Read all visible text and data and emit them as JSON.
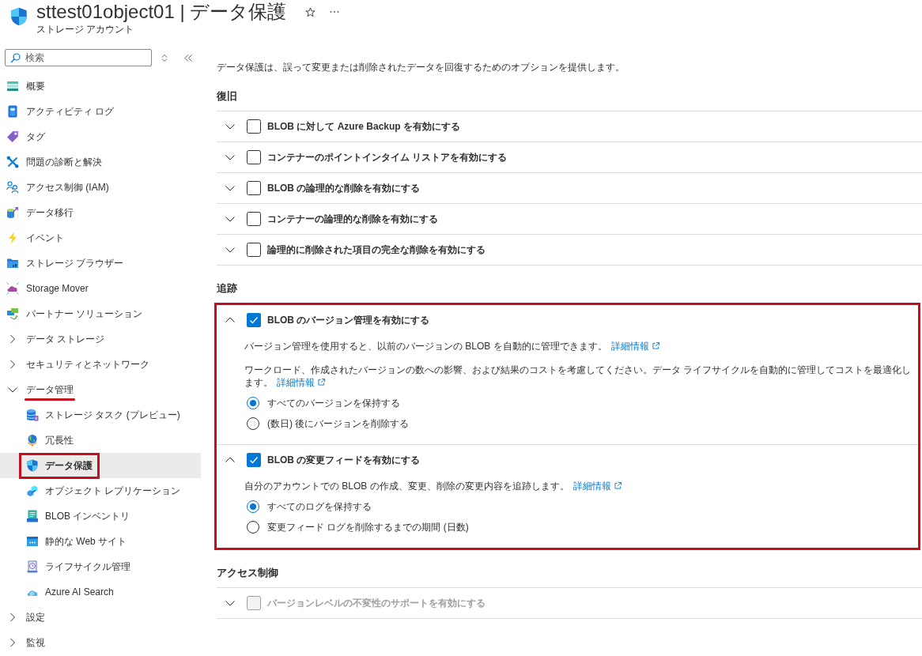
{
  "header": {
    "title": "sttest01object01 | データ保護",
    "subtitle": "ストレージ アカウント"
  },
  "sidebar": {
    "search": {
      "placeholder": "検索"
    },
    "items": [
      {
        "label": "概要",
        "kind": "link",
        "selected": false,
        "highlighted": false,
        "underlined": false
      },
      {
        "label": "アクティビティ ログ",
        "kind": "link",
        "selected": false,
        "highlighted": false,
        "underlined": false
      },
      {
        "label": "タグ",
        "kind": "link",
        "selected": false,
        "highlighted": false,
        "underlined": false
      },
      {
        "label": "問題の診断と解決",
        "kind": "link",
        "selected": false,
        "highlighted": false,
        "underlined": false
      },
      {
        "label": "アクセス制御 (IAM)",
        "kind": "link",
        "selected": false,
        "highlighted": false,
        "underlined": false
      },
      {
        "label": "データ移行",
        "kind": "link",
        "selected": false,
        "highlighted": false,
        "underlined": false
      },
      {
        "label": "イベント",
        "kind": "link",
        "selected": false,
        "highlighted": false,
        "underlined": false
      },
      {
        "label": "ストレージ ブラウザー",
        "kind": "link",
        "selected": false,
        "highlighted": false,
        "underlined": false
      },
      {
        "label": "Storage Mover",
        "kind": "link",
        "selected": false,
        "highlighted": false,
        "underlined": false
      },
      {
        "label": "パートナー ソリューション",
        "kind": "link",
        "selected": false,
        "highlighted": false,
        "underlined": false
      },
      {
        "label": "データ ストレージ",
        "kind": "group",
        "expanded": false,
        "selected": false,
        "highlighted": false,
        "underlined": false
      },
      {
        "label": "セキュリティとネットワーク",
        "kind": "group",
        "expanded": false,
        "selected": false,
        "highlighted": false,
        "underlined": false
      },
      {
        "label": "データ管理",
        "kind": "group",
        "expanded": true,
        "selected": false,
        "highlighted": false,
        "underlined": true,
        "children": [
          {
            "label": "ストレージ タスク (プレビュー)",
            "kind": "link",
            "selected": false,
            "highlighted": false,
            "underlined": false
          },
          {
            "label": "冗長性",
            "kind": "link",
            "selected": false,
            "highlighted": false,
            "underlined": false
          },
          {
            "label": "データ保護",
            "kind": "link",
            "selected": true,
            "highlighted": true,
            "underlined": false
          },
          {
            "label": "オブジェクト レプリケーション",
            "kind": "link",
            "selected": false,
            "highlighted": false,
            "underlined": false
          },
          {
            "label": "BLOB インベントリ",
            "kind": "link",
            "selected": false,
            "highlighted": false,
            "underlined": false
          },
          {
            "label": "静的な Web サイト",
            "kind": "link",
            "selected": false,
            "highlighted": false,
            "underlined": false
          },
          {
            "label": "ライフサイクル管理",
            "kind": "link",
            "selected": false,
            "highlighted": false,
            "underlined": false
          },
          {
            "label": "Azure AI Search",
            "kind": "link",
            "selected": false,
            "highlighted": false,
            "underlined": false
          }
        ]
      },
      {
        "label": "設定",
        "kind": "group",
        "expanded": false,
        "selected": false,
        "highlighted": false,
        "underlined": false
      },
      {
        "label": "監視",
        "kind": "group",
        "expanded": false,
        "selected": false,
        "highlighted": false,
        "underlined": false
      }
    ]
  },
  "main": {
    "description": "データ保護は、誤って変更または削除されたデータを回復するためのオプションを提供します。",
    "sections": [
      {
        "heading": "復旧",
        "highlighted": false,
        "items": [
          {
            "label": "BLOB に対して Azure Backup を有効にする",
            "checked": false,
            "expanded": false,
            "disabled": false
          },
          {
            "label": "コンテナーのポイントインタイム リストアを有効にする",
            "checked": false,
            "expanded": false,
            "disabled": false
          },
          {
            "label": "BLOB の論理的な削除を有効にする",
            "checked": false,
            "expanded": false,
            "disabled": false
          },
          {
            "label": "コンテナーの論理的な削除を有効にする",
            "checked": false,
            "expanded": false,
            "disabled": false
          },
          {
            "label": "論理的に削除された項目の完全な削除を有効にする",
            "checked": false,
            "expanded": false,
            "disabled": false
          }
        ]
      },
      {
        "heading": "追跡",
        "highlighted": true,
        "items": [
          {
            "label": "BLOB のバージョン管理を有効にする",
            "checked": true,
            "expanded": true,
            "disabled": false,
            "details": [
              {
                "text": "バージョン管理を使用すると、以前のバージョンの BLOB を自動的に管理できます。",
                "link": "詳細情報"
              },
              {
                "text": "ワークロード、作成されたバージョンの数への影響、および結果のコストを考慮してください。データ ライフサイクルを自動的に管理してコストを最適化します。",
                "link": "詳細情報"
              }
            ],
            "options": [
              {
                "label": "すべてのバージョンを保持する",
                "selected": true
              },
              {
                "label": "(数日) 後にバージョンを削除する",
                "selected": false
              }
            ]
          },
          {
            "label": "BLOB の変更フィードを有効にする",
            "checked": true,
            "expanded": true,
            "disabled": false,
            "details": [
              {
                "text": "自分のアカウントでの BLOB の作成、変更、削除の変更内容を追跡します。",
                "link": "詳細情報"
              }
            ],
            "options": [
              {
                "label": "すべてのログを保持する",
                "selected": true
              },
              {
                "label": "変更フィード ログを削除するまでの期間 (日数)",
                "selected": false
              }
            ]
          }
        ]
      },
      {
        "heading": "アクセス制御",
        "highlighted": false,
        "items": [
          {
            "label": "バージョンレベルの不変性のサポートを有効にする",
            "checked": false,
            "expanded": false,
            "disabled": true
          }
        ]
      }
    ]
  }
}
